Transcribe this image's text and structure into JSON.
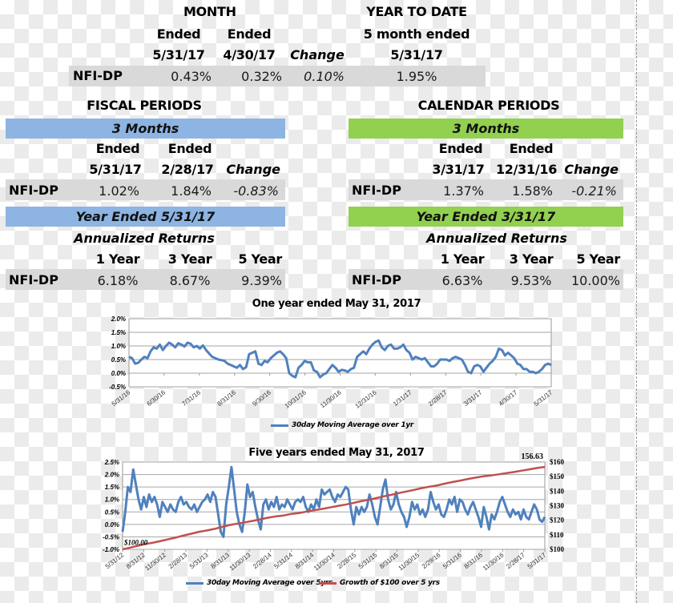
{
  "month": {
    "title": "MONTH",
    "col1": {
      "line1": "Ended",
      "line2": "5/31/17"
    },
    "col2": {
      "line1": "Ended",
      "line2": "4/30/17"
    },
    "col3": {
      "line2": "Change"
    },
    "row": {
      "label": "NFI-DP",
      "v1": "0.43%",
      "v2": "0.32%",
      "v3": "0.10%"
    }
  },
  "ytd": {
    "title": "YEAR TO DATE",
    "line1": "5 month ended",
    "line2": "5/31/17",
    "value": "1.95%"
  },
  "fiscal": {
    "title": "FISCAL PERIODS",
    "band1": "3 Months",
    "col1": {
      "line1": "Ended",
      "line2": "5/31/17"
    },
    "col2": {
      "line1": "Ended",
      "line2": "2/28/17"
    },
    "col3": {
      "line2": "Change"
    },
    "row1": {
      "label": "NFI-DP",
      "v1": "1.02%",
      "v2": "1.84%",
      "v3": "-0.83%"
    },
    "band2": "Year Ended 5/31/17",
    "subtitle": "Annualized Returns",
    "ycols": [
      "1 Year",
      "3 Year",
      "5 Year"
    ],
    "row2": {
      "label": "NFI-DP",
      "v1": "6.18%",
      "v2": "8.67%",
      "v3": "9.39%"
    }
  },
  "calendar": {
    "title": "CALENDAR PERIODS",
    "band1": "3 Months",
    "col1": {
      "line1": "Ended",
      "line2": "3/31/17"
    },
    "col2": {
      "line1": "Ended",
      "line2": "12/31/16"
    },
    "col3": {
      "line2": "Change"
    },
    "row1": {
      "label": "NFI-DP",
      "v1": "1.37%",
      "v2": "1.58%",
      "v3": "-0.21%"
    },
    "band2": "Year Ended 3/31/17",
    "subtitle": "Annualized Returns",
    "ycols": [
      "1 Year",
      "3 Year",
      "5 Year"
    ],
    "row2": {
      "label": "NFI-DP",
      "v1": "6.63%",
      "v2": "9.53%",
      "v3": "10.00%"
    }
  },
  "colors": {
    "blue_band": "#8db4e2",
    "green_band": "#92d050",
    "series_blue": "#4f81bd",
    "series_red": "#c0504d"
  },
  "chart_data": [
    {
      "type": "line",
      "title": "One year ended May 31, 2017",
      "xlabel": "",
      "ylabel": "",
      "ylim": [
        -0.5,
        2.0
      ],
      "yticks": [
        "2.0%",
        "1.5%",
        "1.0%",
        "0.5%",
        "0.0%",
        "-0.5%"
      ],
      "ytick_values": [
        2.0,
        1.5,
        1.0,
        0.5,
        0.0,
        -0.5
      ],
      "x_ticks": [
        "5/31/16",
        "6/30/16",
        "7/31/16",
        "8/31/16",
        "9/30/16",
        "10/31/16",
        "11/30/16",
        "12/31/16",
        "1/31/17",
        "2/28/17",
        "3/31/17",
        "4/30/17",
        "5/31/17"
      ],
      "grid": true,
      "legend": "bottom",
      "series": [
        {
          "name": "30day Moving Average over 1yr",
          "color": "#4f81bd",
          "values": [
            0.6,
            0.55,
            0.35,
            0.38,
            0.5,
            0.6,
            0.55,
            0.8,
            0.95,
            0.9,
            1.05,
            0.85,
            1.0,
            1.12,
            1.05,
            0.95,
            1.1,
            1.05,
            0.98,
            1.12,
            1.08,
            0.95,
            1.0,
            0.9,
            1.02,
            0.85,
            0.72,
            0.6,
            0.55,
            0.5,
            0.48,
            0.45,
            0.35,
            0.3,
            0.25,
            0.2,
            0.3,
            0.15,
            0.22,
            0.7,
            0.75,
            0.8,
            0.35,
            0.3,
            0.45,
            0.4,
            0.55,
            0.65,
            0.75,
            0.8,
            0.7,
            0.55,
            0.0,
            -0.1,
            -0.15,
            0.2,
            0.3,
            0.45,
            0.4,
            0.4,
            0.1,
            0.05,
            -0.15,
            -0.05,
            0.0,
            0.15,
            0.3,
            0.2,
            0.05,
            0.12,
            0.1,
            0.05,
            0.15,
            0.2,
            0.6,
            0.7,
            0.8,
            0.7,
            0.9,
            1.05,
            1.15,
            1.2,
            0.95,
            0.85,
            1.0,
            1.05,
            0.9,
            0.9,
            0.95,
            1.05,
            0.85,
            0.75,
            0.5,
            0.6,
            0.55,
            0.5,
            0.55,
            0.4,
            0.25,
            0.25,
            0.35,
            0.5,
            0.5,
            0.5,
            0.45,
            0.55,
            0.6,
            0.55,
            0.5,
            0.3,
            0.05,
            0.0,
            0.25,
            0.3,
            0.25,
            0.05,
            0.2,
            0.35,
            0.45,
            0.6,
            0.9,
            0.85,
            0.65,
            0.75,
            0.65,
            0.55,
            0.35,
            0.3,
            0.15,
            0.15,
            0.05,
            0.05,
            0.0,
            0.05,
            0.15,
            0.3,
            0.35,
            0.3
          ]
        }
      ]
    },
    {
      "type": "line",
      "title": "Five years ended May 31, 2017",
      "xlabel": "",
      "ylabel": "",
      "ylim": [
        -1.0,
        2.5
      ],
      "yticks": [
        "2.5%",
        "2.0%",
        "1.5%",
        "1.0%",
        "0.5%",
        "0.0%",
        "-0.5%",
        "-1.0%"
      ],
      "ytick_values": [
        2.5,
        2.0,
        1.5,
        1.0,
        0.5,
        0.0,
        -0.5,
        -1.0
      ],
      "y2lim": [
        100,
        160
      ],
      "y2ticks": [
        "$160",
        "$150",
        "$140",
        "$130",
        "$120",
        "$110",
        "$100"
      ],
      "y2tick_values": [
        160,
        150,
        140,
        130,
        120,
        110,
        100
      ],
      "x_ticks": [
        "5/31/12",
        "8/31/12",
        "11/30/12",
        "2/28/13",
        "5/31/13",
        "8/31/13",
        "11/30/13",
        "2/28/14",
        "5/31/14",
        "8/31/14",
        "11/30/14",
        "2/28/15",
        "5/31/15",
        "8/31/15",
        "11/30/15",
        "2/29/16",
        "5/31/16",
        "8/31/16",
        "11/30/16",
        "2/28/17",
        "5/31/17"
      ],
      "annotations": [
        {
          "text": "$100.00",
          "at": "start"
        },
        {
          "text": "156.63",
          "at": "end"
        }
      ],
      "grid": true,
      "legend": "bottom",
      "series": [
        {
          "name": "30day Moving Average over 5yrs",
          "color": "#4f81bd",
          "axis": "left",
          "values": [
            -0.3,
            0.5,
            1.5,
            1.3,
            2.2,
            1.6,
            1.0,
            0.6,
            1.1,
            0.7,
            1.2,
            0.9,
            1.1,
            0.8,
            0.3,
            0.9,
            0.7,
            0.5,
            0.8,
            0.6,
            0.5,
            0.9,
            1.1,
            0.8,
            0.9,
            0.7,
            0.6,
            0.8,
            0.5,
            0.7,
            0.9,
            1.0,
            1.2,
            0.9,
            1.3,
            1.1,
            0.4,
            -0.3,
            -0.5,
            0.8,
            1.5,
            2.3,
            1.4,
            0.5,
            0.0,
            -0.3,
            0.5,
            1.6,
            1.1,
            1.3,
            0.7,
            0.2,
            -0.2,
            0.8,
            1.0,
            0.6,
            0.9,
            0.7,
            1.1,
            0.6,
            0.8,
            0.7,
            1.0,
            0.8,
            0.6,
            0.9,
            1.0,
            0.9,
            1.1,
            0.7,
            0.5,
            0.8,
            0.6,
            1.0,
            0.7,
            1.4,
            1.2,
            1.3,
            1.4,
            1.1,
            0.9,
            1.2,
            1.1,
            1.3,
            1.5,
            1.4,
            0.6,
            0.0,
            0.7,
            0.4,
            0.7,
            0.5,
            0.7,
            1.2,
            0.8,
            0.3,
            0.0,
            0.7,
            1.4,
            1.8,
            1.0,
            0.6,
            0.8,
            1.3,
            0.8,
            0.5,
            0.3,
            -0.1,
            0.3,
            0.9,
            0.6,
            0.8,
            0.4,
            0.6,
            0.3,
            0.6,
            1.3,
            0.9,
            0.6,
            0.8,
            0.4,
            0.3,
            0.6,
            1.0,
            0.8,
            1.1,
            0.5,
            1.0,
            0.9,
            0.6,
            0.4,
            0.7,
            0.9,
            0.6,
            0.3,
            -0.1,
            0.7,
            0.3,
            -0.2,
            0.4,
            0.2,
            0.5,
            0.9,
            1.1,
            0.8,
            0.5,
            0.3,
            0.6,
            0.4,
            0.5,
            0.2,
            0.6,
            0.3,
            0.2,
            0.5,
            0.8,
            0.6,
            0.2,
            0.1,
            0.3
          ]
        },
        {
          "name": "Growth of $100 over 5 yrs",
          "color": "#c0504d",
          "axis": "right",
          "values": [
            100.0,
            101.2,
            102.5,
            103.7,
            104.6,
            105.8,
            107.0,
            108.2,
            109.6,
            110.8,
            112.1,
            113.0,
            114.1,
            115.5,
            116.8,
            117.7,
            118.6,
            119.6,
            120.7,
            121.8,
            122.7,
            123.3,
            124.4,
            125.0,
            126.0,
            126.9,
            127.8,
            128.8,
            129.8,
            130.7,
            131.8,
            133.0,
            134.0,
            135.2,
            136.4,
            137.5,
            138.7,
            139.8,
            140.9,
            142.1,
            143.1,
            144.0,
            145.2,
            146.3,
            147.3,
            148.4,
            149.3,
            150.2,
            150.8,
            151.6,
            152.4,
            153.2,
            154.1,
            155.0,
            155.9,
            156.63
          ]
        }
      ]
    }
  ]
}
